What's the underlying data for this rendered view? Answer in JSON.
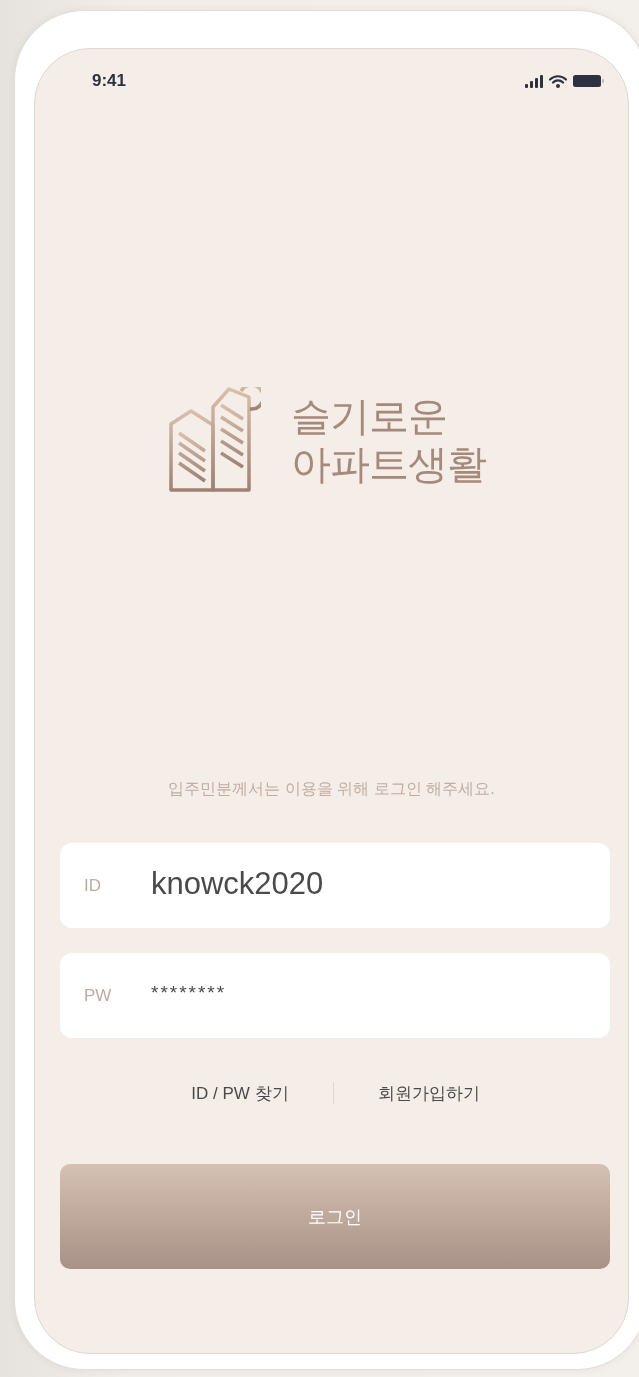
{
  "status_bar": {
    "time": "9:41"
  },
  "logo": {
    "line_1": "슬기로운",
    "line_2": "아파트생활"
  },
  "message": "입주민분께서는 이용을 위해 로그인 해주세요.",
  "fields": [
    {
      "kind": "text",
      "label": "ID",
      "value": "knowck2020"
    },
    {
      "kind": "password",
      "label": "PW",
      "value": "********"
    }
  ],
  "links": [
    "ID / PW 찾기",
    "회원가입하기"
  ],
  "login_button": "로그인"
}
